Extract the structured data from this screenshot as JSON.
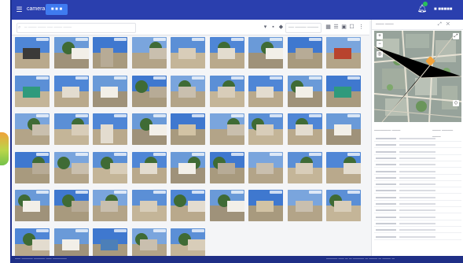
{
  "topbar": {
    "brand": "camera",
    "active_tab": "■ ■ ■"
  },
  "user": {
    "label": "■ ■■■■■"
  },
  "toolbar": {
    "search_placeholder": "─ ─── ─── ── ─── ───",
    "sort_label": "── ──── ────"
  },
  "panel": {
    "title": "─── ───",
    "list_header_left": "────── ───",
    "list_header_right": "─── ──── ───"
  },
  "status": {
    "left": "── ──── ──── ── ─────",
    "right": "──── ── ─ ─ ──── ─ ─── ─ ─── ─"
  },
  "colors": {
    "topbar": "#2a3fae",
    "accent": "#3f7bf0",
    "statusbar": "#1f2f86"
  },
  "photos": [
    {
      "scene": "garage-dark"
    },
    {
      "scene": "street-trees"
    },
    {
      "scene": "white-wall"
    },
    {
      "scene": "street-houses"
    },
    {
      "scene": "parking-car"
    },
    {
      "scene": "house-tree"
    },
    {
      "scene": "street-trees"
    },
    {
      "scene": "white-building"
    },
    {
      "scene": "red-building"
    },
    {
      "scene": "green-wall"
    },
    {
      "scene": "dirt-lot"
    },
    {
      "scene": "house-fence"
    },
    {
      "scene": "street-houses"
    },
    {
      "scene": "house-tree"
    },
    {
      "scene": "house-trees"
    },
    {
      "scene": "block-house"
    },
    {
      "scene": "house-tree"
    },
    {
      "scene": "teal-house"
    },
    {
      "scene": "street-houses"
    },
    {
      "scene": "street-houses"
    },
    {
      "scene": "tall-house"
    },
    {
      "scene": "street-house"
    },
    {
      "scene": "big-rock"
    },
    {
      "scene": "street-houses"
    },
    {
      "scene": "house-tree"
    },
    {
      "scene": "house-trees"
    },
    {
      "scene": "shed"
    },
    {
      "scene": "street-houses"
    },
    {
      "scene": "street-house"
    },
    {
      "scene": "street-houses"
    },
    {
      "scene": "house-tree"
    },
    {
      "scene": "tree-road"
    },
    {
      "scene": "house-tree"
    },
    {
      "scene": "white-block"
    },
    {
      "scene": "house-tree"
    },
    {
      "scene": "street-trees"
    },
    {
      "scene": "tree-lot"
    },
    {
      "scene": "street-house"
    },
    {
      "scene": "house-tree"
    },
    {
      "scene": "white-house"
    },
    {
      "scene": "street-houses"
    },
    {
      "scene": "street-trees"
    },
    {
      "scene": "dirt-mound"
    },
    {
      "scene": "tunnel"
    },
    {
      "scene": "house-tree"
    },
    {
      "scene": "street-trees"
    },
    {
      "scene": "block-house"
    },
    {
      "scene": "blue-wall"
    },
    {
      "scene": "house-tree"
    },
    {
      "scene": "street-houses"
    }
  ],
  "list_rows": 16
}
